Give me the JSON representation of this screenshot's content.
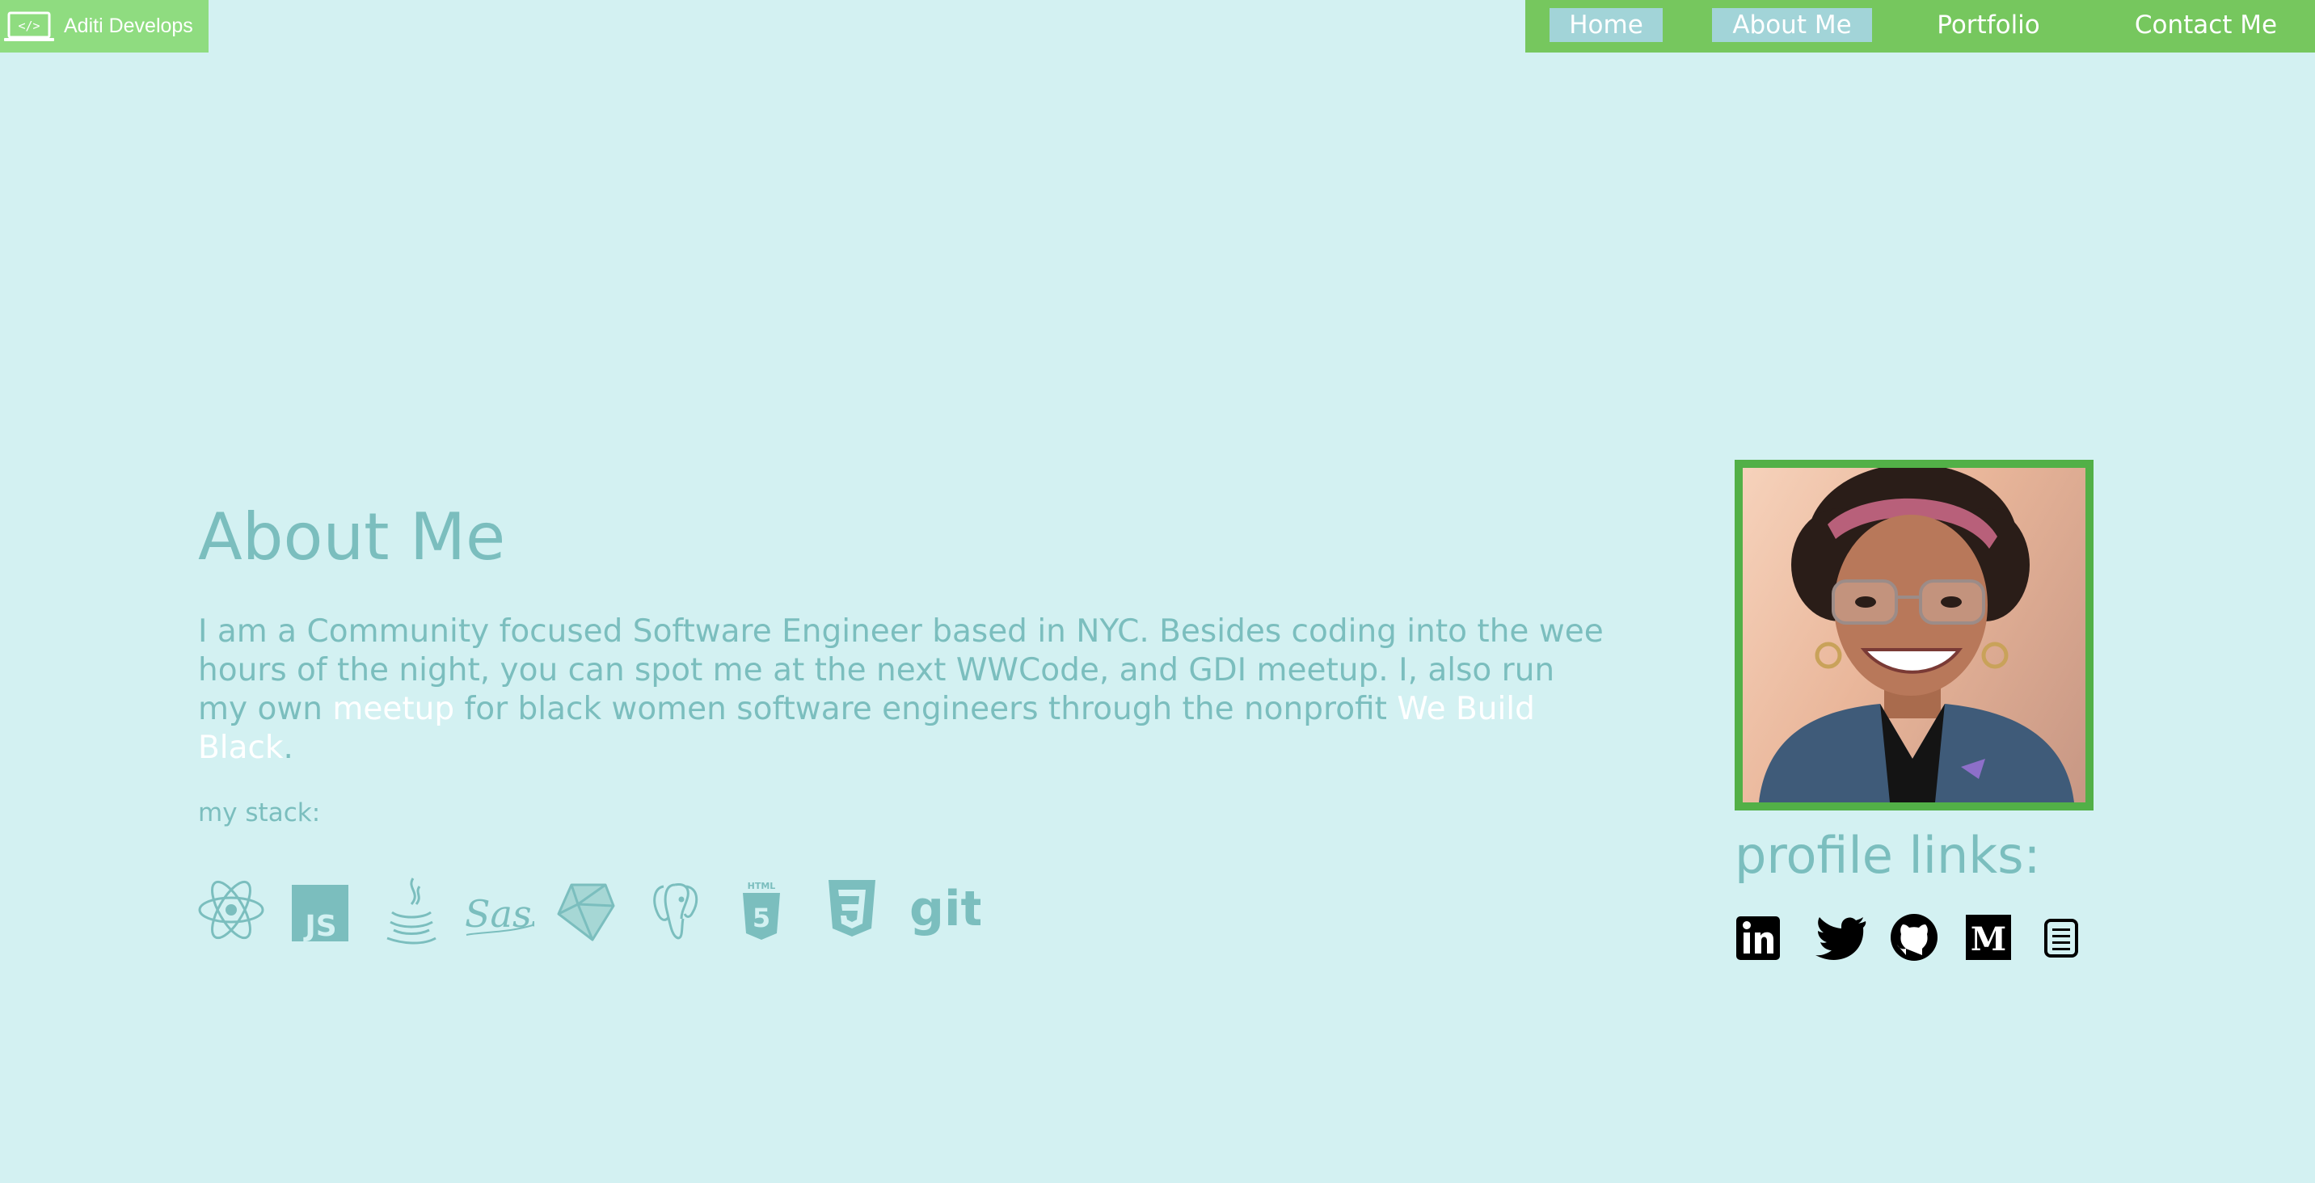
{
  "brand": {
    "name": "Aditi Develops",
    "logo_icon": "laptop-code-icon"
  },
  "nav": {
    "items": [
      {
        "label": "Home",
        "active": true
      },
      {
        "label": "About Me",
        "active": true
      },
      {
        "label": "Portfolio",
        "active": false
      },
      {
        "label": "Contact Me",
        "active": false
      }
    ]
  },
  "about": {
    "title": "About Me",
    "bio_part1": "I am a Community focused Software Engineer based in NYC. Besides coding into the wee hours of the night, you can spot me at the next WWCode, and GDI meetup. I, also run my own ",
    "bio_link1": "meetup",
    "bio_part2": " for black women software engineers through the nonprofit ",
    "bio_link2": "We Build Black",
    "bio_part3": "."
  },
  "stack": {
    "label": "my stack:",
    "icons": [
      "react-icon",
      "javascript-icon",
      "java-icon",
      "sass-icon",
      "ruby-icon",
      "postgresql-icon",
      "html5-icon",
      "css3-icon",
      "git-icon"
    ],
    "js_text": "JS",
    "html_text": "HTML",
    "git_text": "git"
  },
  "profile": {
    "photo": "profile-photo",
    "title": "profile links:",
    "links": [
      "linkedin-icon",
      "twitter-icon",
      "github-icon",
      "medium-icon",
      "resume-icon"
    ],
    "medium_text": "M"
  },
  "colors": {
    "background": "#d3f1f2",
    "nav_green": "#76c75e",
    "brand_green": "#8fdc80",
    "active_tab": "#a2d4d8",
    "teal_text": "#7bbebe",
    "photo_border": "#52b047"
  }
}
